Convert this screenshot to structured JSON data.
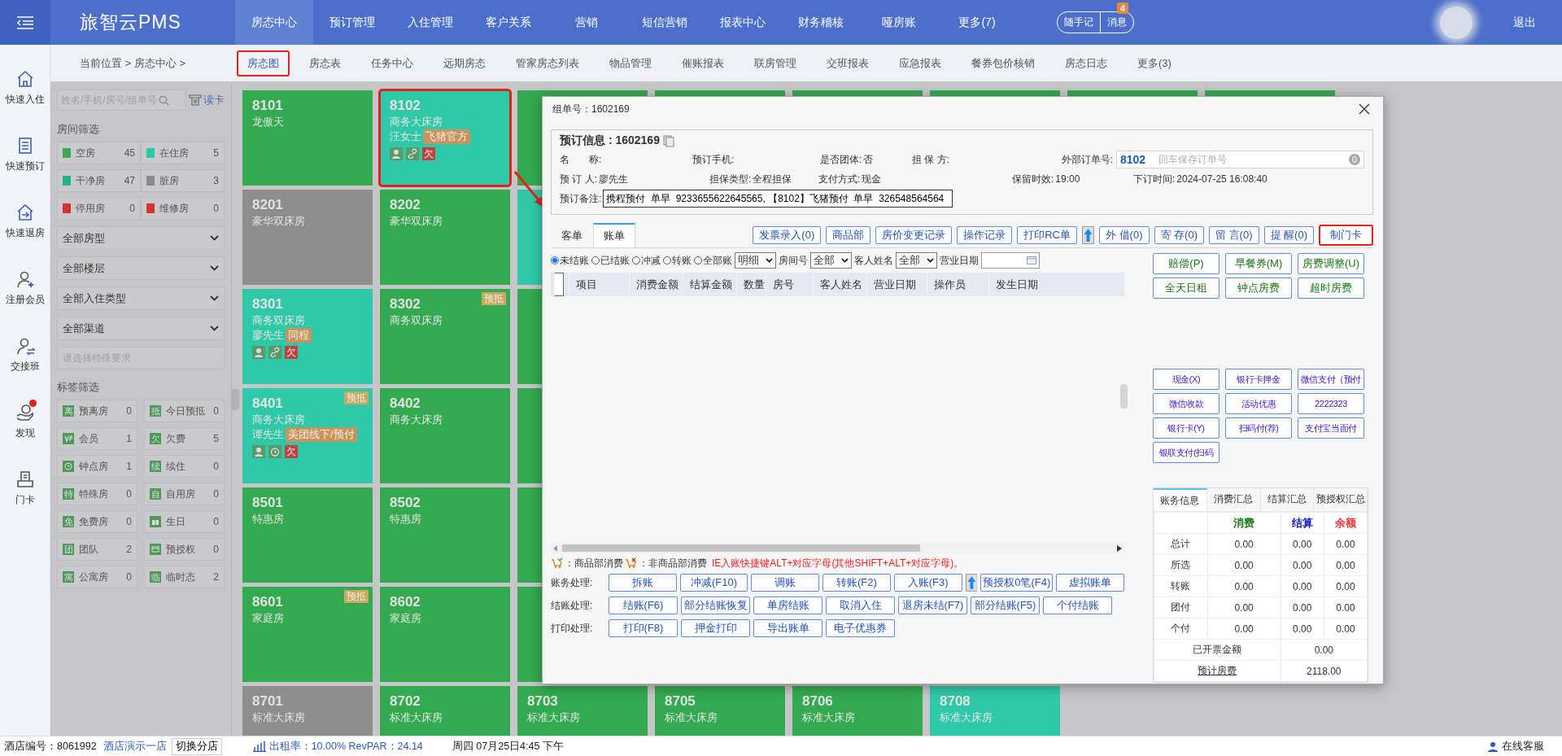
{
  "topbar": {
    "logo": "旅智云PMS",
    "nav": [
      {
        "label": "房态中心",
        "selected": true
      },
      {
        "label": "预订管理",
        "selected": false
      },
      {
        "label": "入住管理",
        "selected": false
      },
      {
        "label": "客户关系",
        "selected": false
      },
      {
        "label": "营销",
        "selected": false
      },
      {
        "label": "短信营销",
        "selected": false
      },
      {
        "label": "报表中心",
        "selected": false
      },
      {
        "label": "财务稽核",
        "selected": false
      },
      {
        "label": "哑房账",
        "selected": false
      },
      {
        "label": "更多(7)",
        "selected": false
      }
    ],
    "quick_note": "随手记",
    "messages": "消息",
    "message_badge": "4",
    "logout": "退出"
  },
  "subnav": {
    "breadcrumb": "当前位置 > 房态中心 >",
    "tabs": [
      {
        "label": "房态图",
        "selected": true,
        "highlighted": true
      },
      {
        "label": "房态表",
        "selected": false,
        "highlighted": false
      },
      {
        "label": "任务中心",
        "selected": false,
        "highlighted": false
      },
      {
        "label": "远期房态",
        "selected": false,
        "highlighted": false
      },
      {
        "label": "管家房态列表",
        "selected": false,
        "highlighted": false
      },
      {
        "label": "物品管理",
        "selected": false,
        "highlighted": false
      },
      {
        "label": "催账报表",
        "selected": false,
        "highlighted": false
      },
      {
        "label": "联房管理",
        "selected": false,
        "highlighted": false
      },
      {
        "label": "交班报表",
        "selected": false,
        "highlighted": false
      },
      {
        "label": "应急报表",
        "selected": false,
        "highlighted": false
      },
      {
        "label": "餐券包价核销",
        "selected": false,
        "highlighted": false
      },
      {
        "label": "房态日志",
        "selected": false,
        "highlighted": false
      },
      {
        "label": "更多(3)",
        "selected": false,
        "highlighted": false
      }
    ]
  },
  "sidebar": {
    "items": [
      {
        "label": "快速入住",
        "notify": false
      },
      {
        "label": "快速预订",
        "notify": false
      },
      {
        "label": "快速退房",
        "notify": false
      },
      {
        "label": "注册会员",
        "notify": false
      },
      {
        "label": "交接班",
        "notify": false
      },
      {
        "label": "发现",
        "notify": true
      },
      {
        "label": "门卡",
        "notify": false
      }
    ]
  },
  "filter": {
    "search_placeholder": "姓名/手机/房号/组单号",
    "read_card": "读卡",
    "room_title": "房间筛选",
    "room_filters": [
      {
        "label": "空房",
        "count": "45",
        "color": "#3fa655"
      },
      {
        "label": "在住房",
        "count": "5",
        "color": "#2fc9a8"
      },
      {
        "label": "干净房",
        "count": "47",
        "color": "#27b08e"
      },
      {
        "label": "脏房",
        "count": "3",
        "color": "#8a8a8a"
      },
      {
        "label": "停用房",
        "count": "0",
        "color": "#d23434"
      },
      {
        "label": "维修房",
        "count": "0",
        "color": "#d23435"
      }
    ],
    "dropdowns": [
      "全部房型",
      "全部楼层",
      "全部入住类型",
      "全部渠道"
    ],
    "special_placeholder": "请选择特殊要求",
    "tag_title": "标签筛选",
    "tags": [
      {
        "kind": "char",
        "mark": "离",
        "label": "预离房",
        "count": "0"
      },
      {
        "kind": "char",
        "mark": "抵",
        "label": "今日预抵",
        "count": "0"
      },
      {
        "kind": "vip",
        "label": "会员",
        "count": "1"
      },
      {
        "kind": "char",
        "mark": "欠",
        "label": "欠费",
        "count": "5"
      },
      {
        "kind": "clock",
        "label": "钟点房",
        "count": "1"
      },
      {
        "kind": "char",
        "mark": "续",
        "label": "续住",
        "count": "0"
      },
      {
        "kind": "char",
        "mark": "特",
        "label": "特殊房",
        "count": "0"
      },
      {
        "kind": "char",
        "mark": "自",
        "label": "自用房",
        "count": "0"
      },
      {
        "kind": "char",
        "mark": "免",
        "label": "免费房",
        "count": "0"
      },
      {
        "kind": "gift",
        "label": "生日",
        "count": "0"
      },
      {
        "kind": "char",
        "mark": "团",
        "label": "团队",
        "count": "2"
      },
      {
        "kind": "card",
        "label": "预授权",
        "count": "0"
      },
      {
        "kind": "char",
        "mark": "寓",
        "label": "公寓房",
        "count": "0"
      },
      {
        "kind": "char",
        "mark": "临",
        "label": "临时态",
        "count": "2"
      }
    ]
  },
  "rooms": {
    "rows": [
      [
        {
          "number": "8101",
          "type": "龙傲天",
          "kind": "vacant",
          "highlighted": false
        },
        {
          "number": "8102",
          "type": "商务大床房",
          "guest": "汪女士",
          "channel": "飞猪官方",
          "flags": [
            {
              "kind": "person"
            },
            {
              "kind": "link"
            },
            {
              "kind": "char",
              "mark": "欠"
            }
          ],
          "kind": "occupied",
          "highlighted": true
        },
        {
          "kind": "vacant",
          "highlighted": false
        },
        {
          "kind": "vacant",
          "highlighted": false
        },
        {
          "kind": "vacant",
          "highlighted": false
        },
        {
          "kind": "vacant",
          "highlighted": false
        },
        {
          "kind": "vacant",
          "highlighted": false
        },
        {
          "kind": "vacant",
          "highlighted": false
        }
      ],
      [
        {
          "number": "8201",
          "type": "豪华双床房",
          "kind": "dirty",
          "highlighted": false
        },
        {
          "number": "8202",
          "type": "豪华双床房",
          "kind": "vacant",
          "highlighted": false
        },
        {
          "kind": "occupied",
          "highlighted": false
        }
      ],
      [
        {
          "number": "8301",
          "type": "商务双床房",
          "guest": "廖先生",
          "channel": "同程",
          "flags": [
            {
              "kind": "person"
            },
            {
              "kind": "link"
            },
            {
              "kind": "char",
              "mark": "欠"
            }
          ],
          "kind": "occupied",
          "highlighted": false
        },
        {
          "number": "8302",
          "type": "商务双床房",
          "corner": "预抵",
          "kind": "vacant",
          "highlighted": false
        },
        {
          "kind": "vacant",
          "highlighted": false
        }
      ],
      [
        {
          "number": "8401",
          "type": "商务大床房",
          "guest": "谭先生",
          "channel": "美团线下/预付",
          "flags": [
            {
              "kind": "person"
            },
            {
              "kind": "clock"
            },
            {
              "kind": "char",
              "mark": "欠"
            }
          ],
          "corner": "预抵",
          "kind": "occupied",
          "highlighted": false
        },
        {
          "number": "8402",
          "type": "商务大床房",
          "kind": "vacant",
          "highlighted": false
        },
        {
          "kind": "vacant",
          "highlighted": false
        }
      ],
      [
        {
          "number": "8501",
          "type": "特惠房",
          "kind": "vacant",
          "highlighted": false
        },
        {
          "number": "8502",
          "type": "特惠房",
          "kind": "vacant",
          "highlighted": false
        },
        {
          "kind": "vacant",
          "highlighted": false
        }
      ],
      [
        {
          "number": "8601",
          "type": "家庭房",
          "corner": "预抵",
          "kind": "vacant",
          "highlighted": false
        },
        {
          "number": "8602",
          "type": "家庭房",
          "kind": "vacant",
          "highlighted": false
        },
        {
          "kind": "vacant",
          "highlighted": false
        }
      ],
      [
        {
          "number": "8701",
          "type": "标准大床房",
          "kind": "dirty",
          "highlighted": false
        },
        {
          "number": "8702",
          "type": "标准大床房",
          "kind": "vacant",
          "highlighted": false
        },
        {
          "number": "8703",
          "type": "标准大床房",
          "kind": "vacant",
          "highlighted": false
        },
        {
          "number": "8705",
          "type": "标准大床房",
          "kind": "vacant",
          "highlighted": false
        },
        {
          "number": "8706",
          "type": "标准大床房",
          "kind": "vacant",
          "highlighted": false
        },
        {
          "number": "8708",
          "type": "标准大床房",
          "kind": "occupied",
          "highlighted": false
        }
      ]
    ]
  },
  "dialog": {
    "title": "组单号：1602169",
    "booking": {
      "title": "预订信息 : 1602169",
      "rows": [
        [
          {
            "kind": "text",
            "label": "名　　称:"
          },
          {
            "kind": "text",
            "label": "预订手机:"
          },
          {
            "kind": "text",
            "label": "是否团体:",
            "value": "否"
          },
          {
            "kind": "text",
            "label": "担 保 方:"
          },
          {
            "kind": "order_field",
            "label": "外部订单号:",
            "value": "8102",
            "placeholder": "回车保存订单号",
            "count": "0"
          }
        ],
        [
          {
            "kind": "text",
            "label": "预 订 人:",
            "value": "廖先生"
          },
          {
            "kind": "text",
            "label": "担保类型:",
            "value": "全程担保"
          },
          {
            "kind": "text",
            "label": "支付方式:",
            "value": "现金"
          },
          {
            "kind": "text",
            "label": "保留时效:",
            "value": "19:00"
          },
          {
            "kind": "text",
            "label": "下订时间:",
            "value": "2024-07-25 16:08:40"
          }
        ],
        [
          {
            "kind": "remark_field",
            "label": "预订备注:",
            "value": "携程预付  单早  9233655622645565, 【8102】飞猪预付  单早  326548564564"
          }
        ]
      ]
    },
    "tabs": [
      {
        "label": "客单",
        "selected": false
      },
      {
        "label": "账单",
        "selected": true
      }
    ],
    "toolbar": [
      {
        "kind": "button",
        "label": "发票录入(0)",
        "highlighted": false
      },
      {
        "kind": "button",
        "label": "商品部",
        "highlighted": false
      },
      {
        "kind": "button",
        "label": "房价变更记录",
        "highlighted": false
      },
      {
        "kind": "button",
        "label": "操作记录",
        "highlighted": false
      },
      {
        "kind": "button",
        "label": "打印RC单",
        "highlighted": false
      },
      {
        "kind": "icon"
      },
      {
        "kind": "button",
        "label": "外 借(0)",
        "highlighted": false
      },
      {
        "kind": "button",
        "label": "寄 存(0)",
        "highlighted": false
      },
      {
        "kind": "button",
        "label": "留 言(0)",
        "highlighted": false
      },
      {
        "kind": "button",
        "label": "提 醒(0)",
        "highlighted": false
      },
      {
        "kind": "button",
        "label": "制门卡",
        "highlighted": true
      }
    ],
    "radios": [
      {
        "label": "未结账",
        "selected": true
      },
      {
        "label": "已结账",
        "selected": false
      },
      {
        "label": "冲减",
        "selected": false
      },
      {
        "label": "转账",
        "selected": false
      },
      {
        "label": "全部账",
        "selected": false
      }
    ],
    "filters": [
      {
        "kind": "select",
        "value": "明细"
      },
      {
        "kind": "select",
        "label": "房间号",
        "value": "全部"
      },
      {
        "kind": "select",
        "label": "客人姓名",
        "value": "全部"
      },
      {
        "kind": "date",
        "label": "营业日期"
      }
    ],
    "table": {
      "select_all": {
        "checked": false
      },
      "columns": [
        "项目",
        "消费金额",
        "结算金额",
        "数量",
        "房号",
        "客人姓名",
        "营业日期",
        "操作员",
        "发生日期"
      ]
    },
    "legend": [
      {
        "kind": "goods",
        "label": "：商品部消费"
      },
      {
        "kind": "other",
        "label": "：非商品部消费"
      }
    ],
    "hint": "IE入账快捷键ALT+对应字母(其他SHIFT+ALT+对应字母)。",
    "actions": [
      {
        "label": "账务处理:",
        "buttons": [
          {
            "kind": "button",
            "label": "拆账"
          },
          {
            "kind": "button",
            "label": "冲减(F10)"
          },
          {
            "kind": "button",
            "label": "调账"
          },
          {
            "kind": "button",
            "label": "转账(F2)"
          },
          {
            "kind": "button",
            "label": "入账(F3)"
          },
          {
            "kind": "icon"
          },
          {
            "kind": "button",
            "label": "预授权0笔(F4)"
          },
          {
            "kind": "button",
            "label": "虚拟账单"
          }
        ]
      },
      {
        "label": "结账处理:",
        "buttons": [
          {
            "kind": "button",
            "label": "结账(F6)"
          },
          {
            "kind": "button",
            "label": "部分结账恢复"
          },
          {
            "kind": "button",
            "label": "单房结账"
          },
          {
            "kind": "button",
            "label": "取消入住"
          },
          {
            "kind": "button",
            "label": "退房未结(F7)"
          },
          {
            "kind": "button",
            "label": "部分结账(F5)"
          },
          {
            "kind": "button",
            "label": "个付结账"
          }
        ]
      },
      {
        "label": "打印处理:",
        "buttons": [
          {
            "kind": "button",
            "label": "打印(F8)"
          },
          {
            "kind": "button",
            "label": "押金打印"
          },
          {
            "kind": "button",
            "label": "导出账单"
          },
          {
            "kind": "button",
            "label": "电子优惠券"
          }
        ]
      }
    ],
    "charges": [
      "赔偿(P)",
      "早餐券(M)",
      "房费调整(U)",
      "全天日租",
      "钟点房费",
      "超时房费"
    ],
    "payments": [
      "现金(X)",
      "银行卡押金",
      "微信支付（预付",
      "微信收款",
      "活动优惠",
      "2222323",
      "银行卡(Y)",
      "扫码付(荐)",
      "支付宝当面付",
      "银联支付(扫码"
    ],
    "summary": {
      "tabs": [
        {
          "label": "账务信息",
          "selected": true
        },
        {
          "label": "消费汇总",
          "selected": false
        },
        {
          "label": "结算汇总",
          "selected": false
        },
        {
          "label": "预授权汇总",
          "selected": false
        }
      ],
      "columns": [
        {
          "label": "消费",
          "color": "#1d7a1d"
        },
        {
          "label": "结算",
          "color": "#1515d0"
        },
        {
          "label": "余额",
          "color": "#ff3333"
        }
      ],
      "rows": [
        {
          "label": "总计",
          "values": [
            "0.00",
            "0.00",
            "0.00"
          ]
        },
        {
          "label": "所选",
          "values": [
            "0.00",
            "0.00",
            "0.00"
          ]
        },
        {
          "label": "转账",
          "values": [
            "0.00",
            "0.00",
            "0.00"
          ]
        },
        {
          "label": "团付",
          "values": [
            "0.00",
            "0.00",
            "0.00"
          ]
        },
        {
          "label": "个付",
          "values": [
            "0.00",
            "0.00",
            "0.00"
          ]
        }
      ],
      "totals": [
        {
          "kind": "text",
          "label": "已开票金额",
          "value": "0.00"
        },
        {
          "kind": "link",
          "label": "预计房费",
          "value": "2118.00"
        }
      ]
    }
  },
  "status_bar": {
    "hotel_id": "酒店编号：8061992",
    "hotel_name": "酒店演示一店",
    "switch": "切换分店",
    "occupancy": "出租率：10.00% RevPAR：24.14",
    "datetime": "周四 07月25日4:45 下午",
    "support": "在线客服"
  }
}
